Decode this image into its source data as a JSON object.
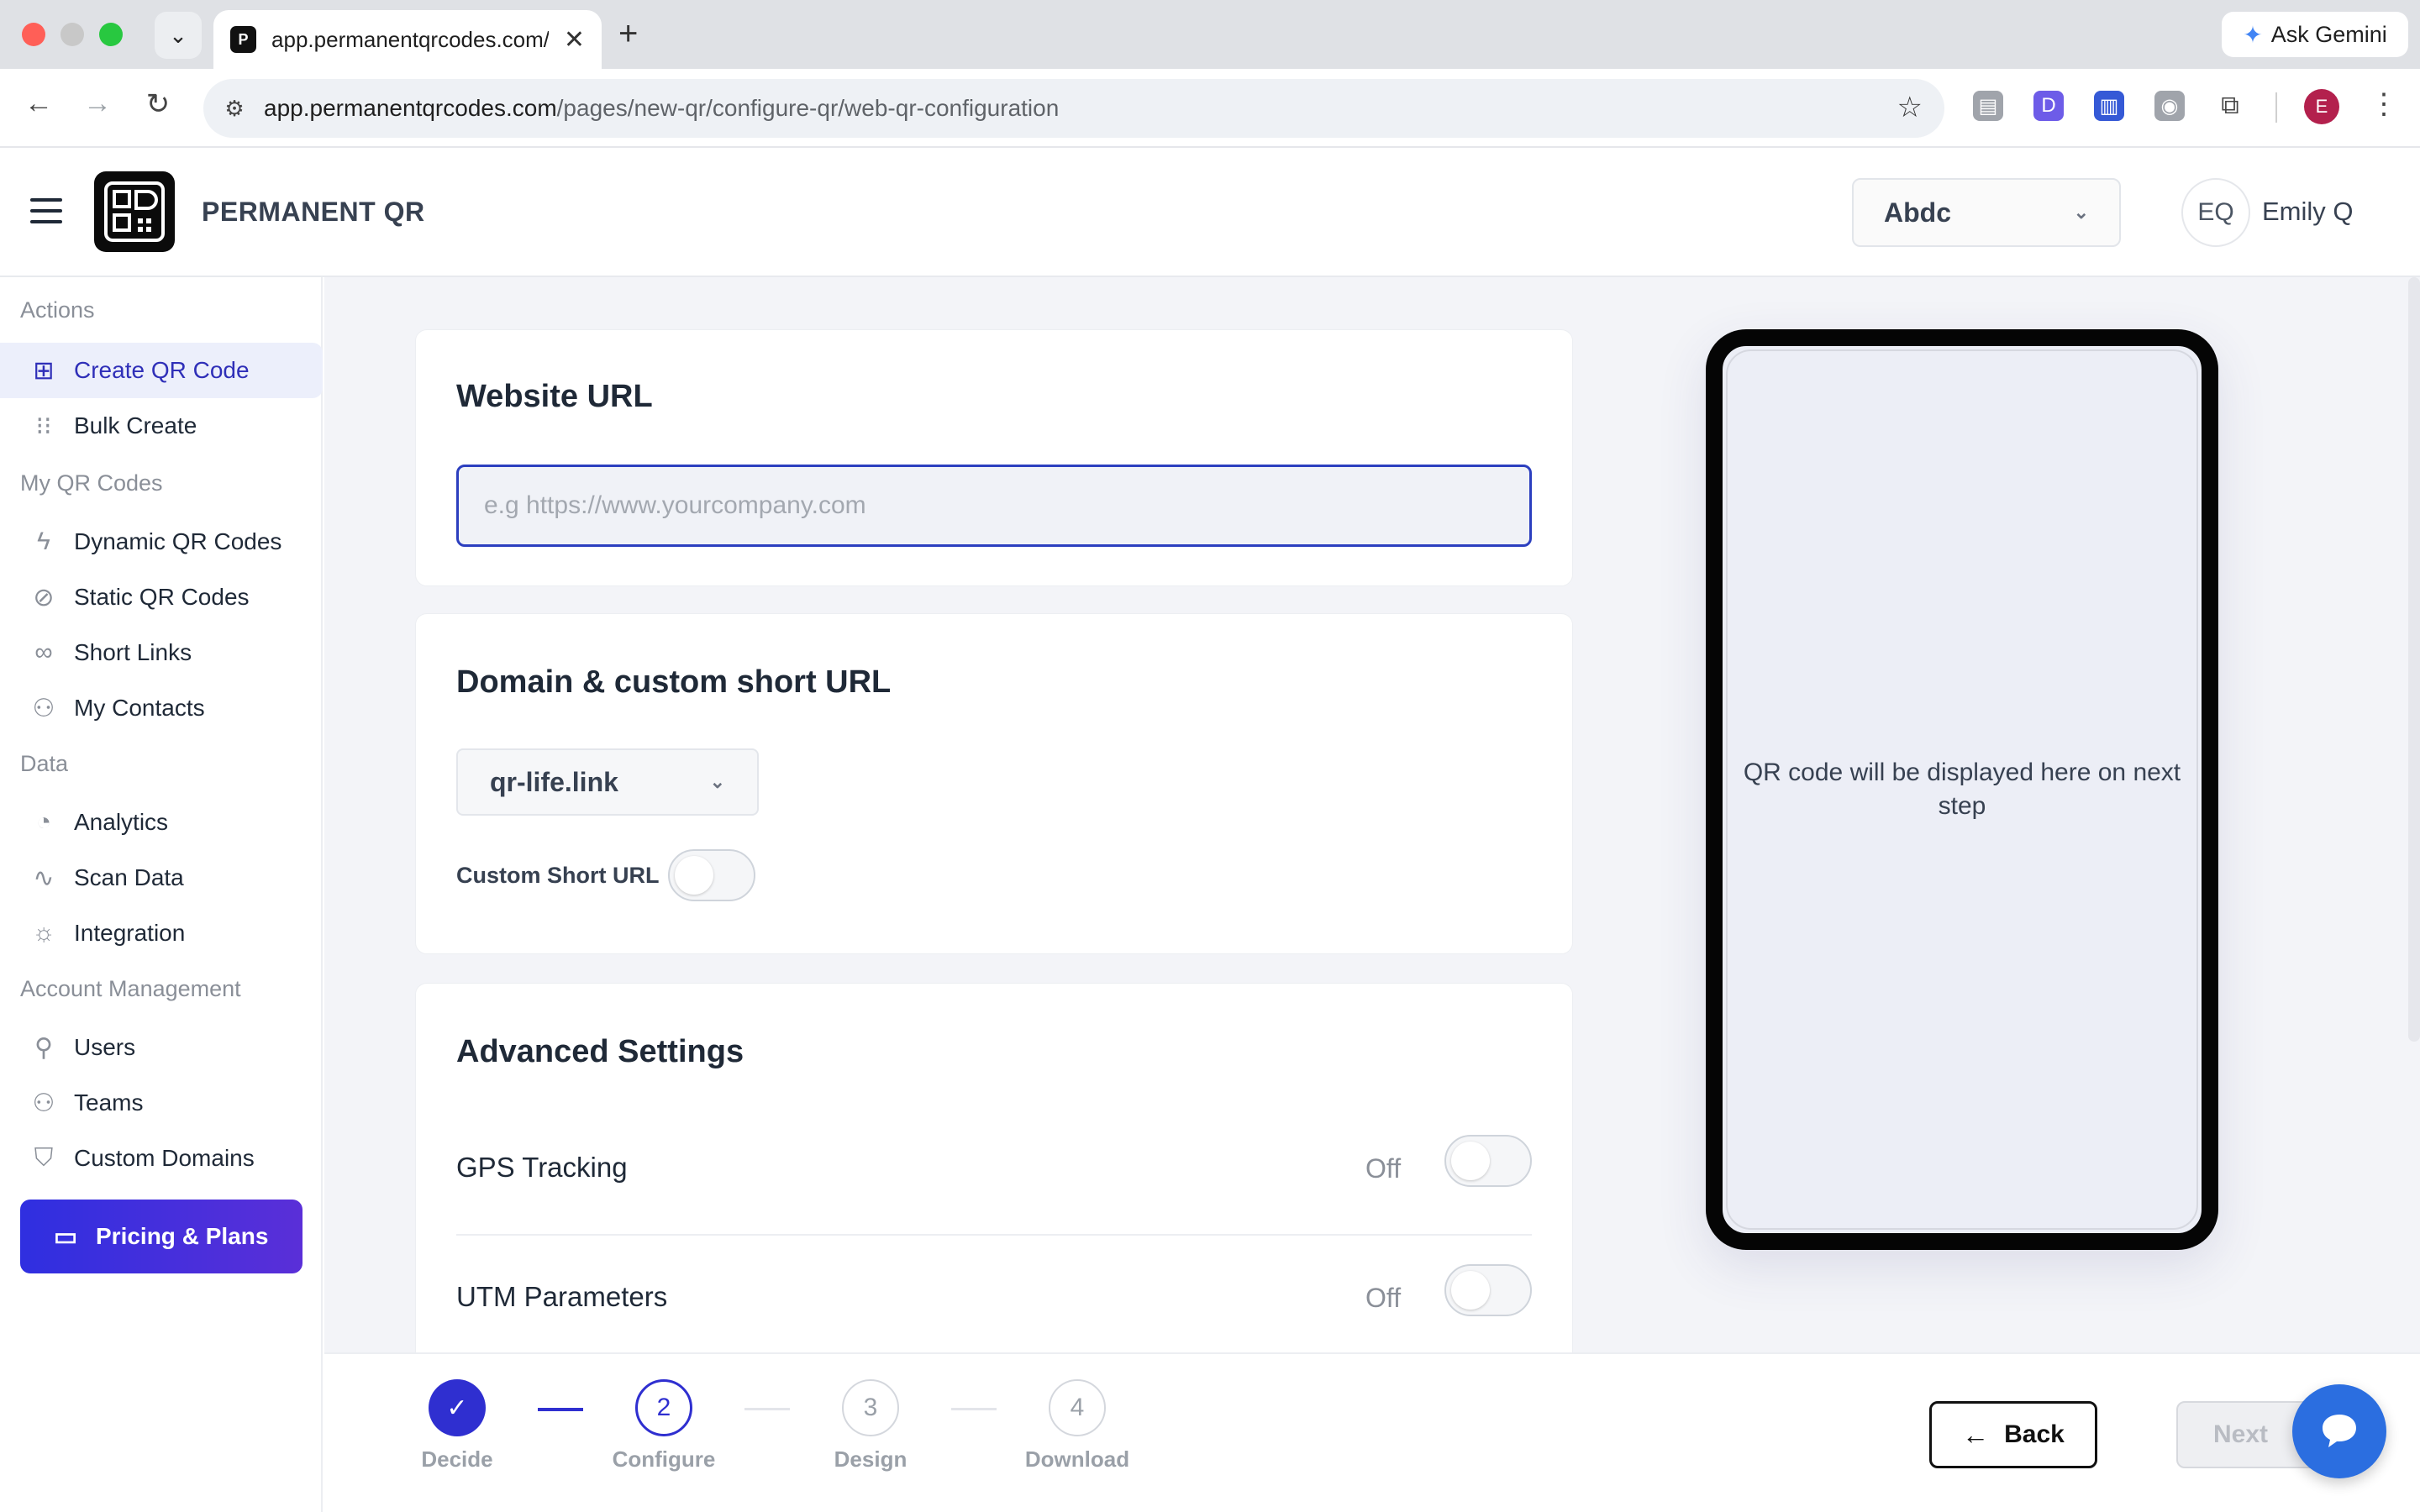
{
  "browser": {
    "tab_title": "app.permanentqrcodes.com/p",
    "tab_favicon": "qr-favicon-icon",
    "new_tab": "+",
    "gemini_label": "Ask Gemini",
    "url_host": "app.permanentqrcodes.com",
    "url_path": "/pages/new-qr/configure-qr/web-qr-configuration",
    "profile_initial": "E"
  },
  "header": {
    "brand": "PERMANENT QR",
    "workspace": "Abdc",
    "user_initials": "EQ",
    "user_name": "Emily Q"
  },
  "sidebar": {
    "sections": [
      {
        "title": "Actions",
        "items": [
          {
            "label": "Create QR Code",
            "icon": "plus-square-icon",
            "active": true
          },
          {
            "label": "Bulk Create",
            "icon": "grid-dots-icon"
          }
        ]
      },
      {
        "title": "My QR Codes",
        "items": [
          {
            "label": "Dynamic QR Codes",
            "icon": "lightning-icon"
          },
          {
            "label": "Static QR Codes",
            "icon": "lightning-off-icon"
          },
          {
            "label": "Short Links",
            "icon": "link-icon"
          },
          {
            "label": "My Contacts",
            "icon": "contacts-icon"
          }
        ]
      },
      {
        "title": "Data",
        "items": [
          {
            "label": "Analytics",
            "icon": "pie-chart-icon"
          },
          {
            "label": "Scan Data",
            "icon": "activity-icon"
          },
          {
            "label": "Integration",
            "icon": "bulb-icon"
          }
        ]
      },
      {
        "title": "Account Management",
        "items": [
          {
            "label": "Users",
            "icon": "user-plus-icon"
          },
          {
            "label": "Teams",
            "icon": "team-icon"
          },
          {
            "label": "Custom Domains",
            "icon": "shield-icon"
          }
        ]
      }
    ],
    "pricing_label": "Pricing & Plans"
  },
  "website_url": {
    "title": "Website URL",
    "placeholder": "e.g https://www.yourcompany.com",
    "value": ""
  },
  "domain": {
    "title": "Domain & custom short URL",
    "selected_domain": "qr-life.link",
    "custom_short_url_label": "Custom Short URL",
    "custom_short_url_enabled": false
  },
  "advanced": {
    "title": "Advanced Settings",
    "rows": [
      {
        "label": "GPS Tracking",
        "state": "Off"
      },
      {
        "label": "UTM Parameters",
        "state": "Off"
      }
    ]
  },
  "preview": {
    "message": "QR code will be displayed here on next step"
  },
  "stepper": {
    "steps": [
      {
        "number": "✓",
        "label": "Decide",
        "status": "done"
      },
      {
        "number": "2",
        "label": "Configure",
        "status": "current"
      },
      {
        "number": "3",
        "label": "Design",
        "status": "todo"
      },
      {
        "number": "4",
        "label": "Download",
        "status": "todo"
      }
    ],
    "back_label": "Back",
    "next_label": "Next"
  },
  "colors": {
    "primary": "#2f2fd0",
    "pricing_gradient_start": "#2f2fe0",
    "pricing_gradient_end": "#5a2fd8",
    "chat": "#2b6ee0"
  }
}
